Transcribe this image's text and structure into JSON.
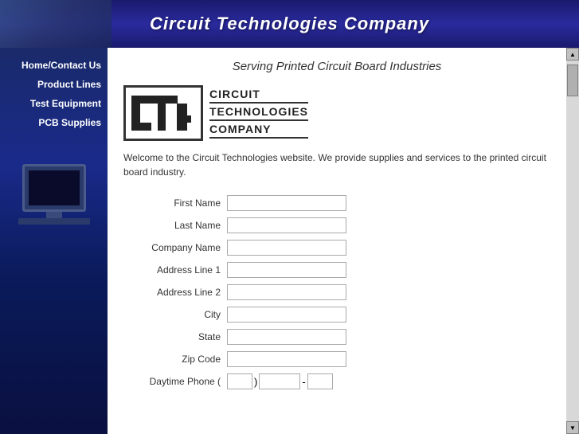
{
  "header": {
    "title": "Circuit Technologies Company",
    "bg_image_alt": "circuit board background"
  },
  "subtitle": "Serving Printed Circuit Board Industries",
  "sidebar": {
    "items": [
      {
        "label": "Home/Contact Us",
        "id": "home"
      },
      {
        "label": "Product Lines",
        "id": "product-lines"
      },
      {
        "label": "Test Equipment",
        "id": "test-equipment"
      },
      {
        "label": "PCB Supplies",
        "id": "pcb-supplies"
      }
    ]
  },
  "logo": {
    "line1": "CIRCUIT",
    "line2": "TECHNOLOGIES",
    "line3": "COMPANY"
  },
  "welcome": {
    "text": "Welcome to the Circuit Technologies website. We provide supplies and services to the printed circuit board industry."
  },
  "form": {
    "fields": [
      {
        "label": "First Name",
        "id": "first-name",
        "type": "text"
      },
      {
        "label": "Last Name",
        "id": "last-name",
        "type": "text"
      },
      {
        "label": "Company Name",
        "id": "company-name",
        "type": "text"
      },
      {
        "label": "Address Line 1",
        "id": "address-line-1",
        "type": "text"
      },
      {
        "label": "Address Line 2",
        "id": "address-line-2",
        "type": "text"
      },
      {
        "label": "City",
        "id": "city",
        "type": "text"
      },
      {
        "label": "State",
        "id": "state",
        "type": "text"
      },
      {
        "label": "Zip Code",
        "id": "zip-code",
        "type": "text"
      }
    ],
    "phone_label": "Daytime Phone (",
    "phone_close": ")",
    "phone_separator": "-"
  },
  "scrollbar": {
    "up_arrow": "▲",
    "down_arrow": "▼"
  }
}
